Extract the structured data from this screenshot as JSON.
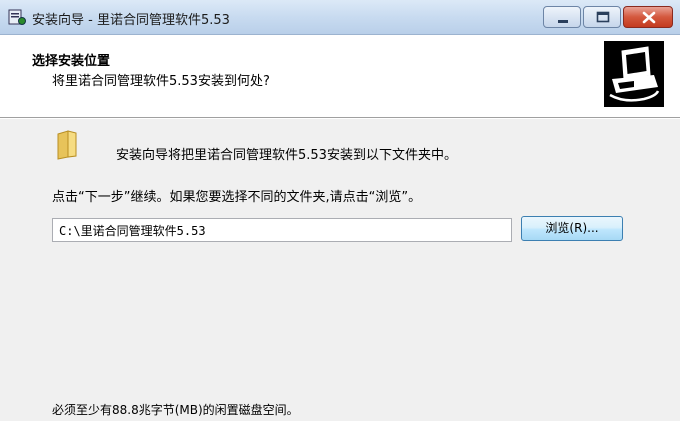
{
  "window": {
    "title": "安装向导 - 里诺合同管理软件5.53",
    "icons": {
      "app": "installer-app-icon",
      "minimize": "minimize-icon",
      "maximize": "maximize-icon",
      "close": "close-icon"
    }
  },
  "header": {
    "title": "选择安装位置",
    "subtitle": "将里诺合同管理软件5.53安装到何处?",
    "logo_icon": "computer-install-logo-icon"
  },
  "body": {
    "folder_icon": "folder-icon",
    "intro": "安装向导将把里诺合同管理软件5.53安装到以下文件夹中。",
    "hint": "点击“下一步”继续。如果您要选择不同的文件夹,请点击“浏览”。",
    "path_value": "C:\\里诺合同管理软件5.53",
    "browse_label": "浏览(R)...",
    "space_required": "必须至少有88.8兆字节(MB)的闲置磁盘空间。"
  },
  "colors": {
    "titlebar": "#c8dbf0",
    "close_button": "#c33a1f",
    "dialog_background": "#f0f0f0",
    "header_background": "#ffffff"
  }
}
